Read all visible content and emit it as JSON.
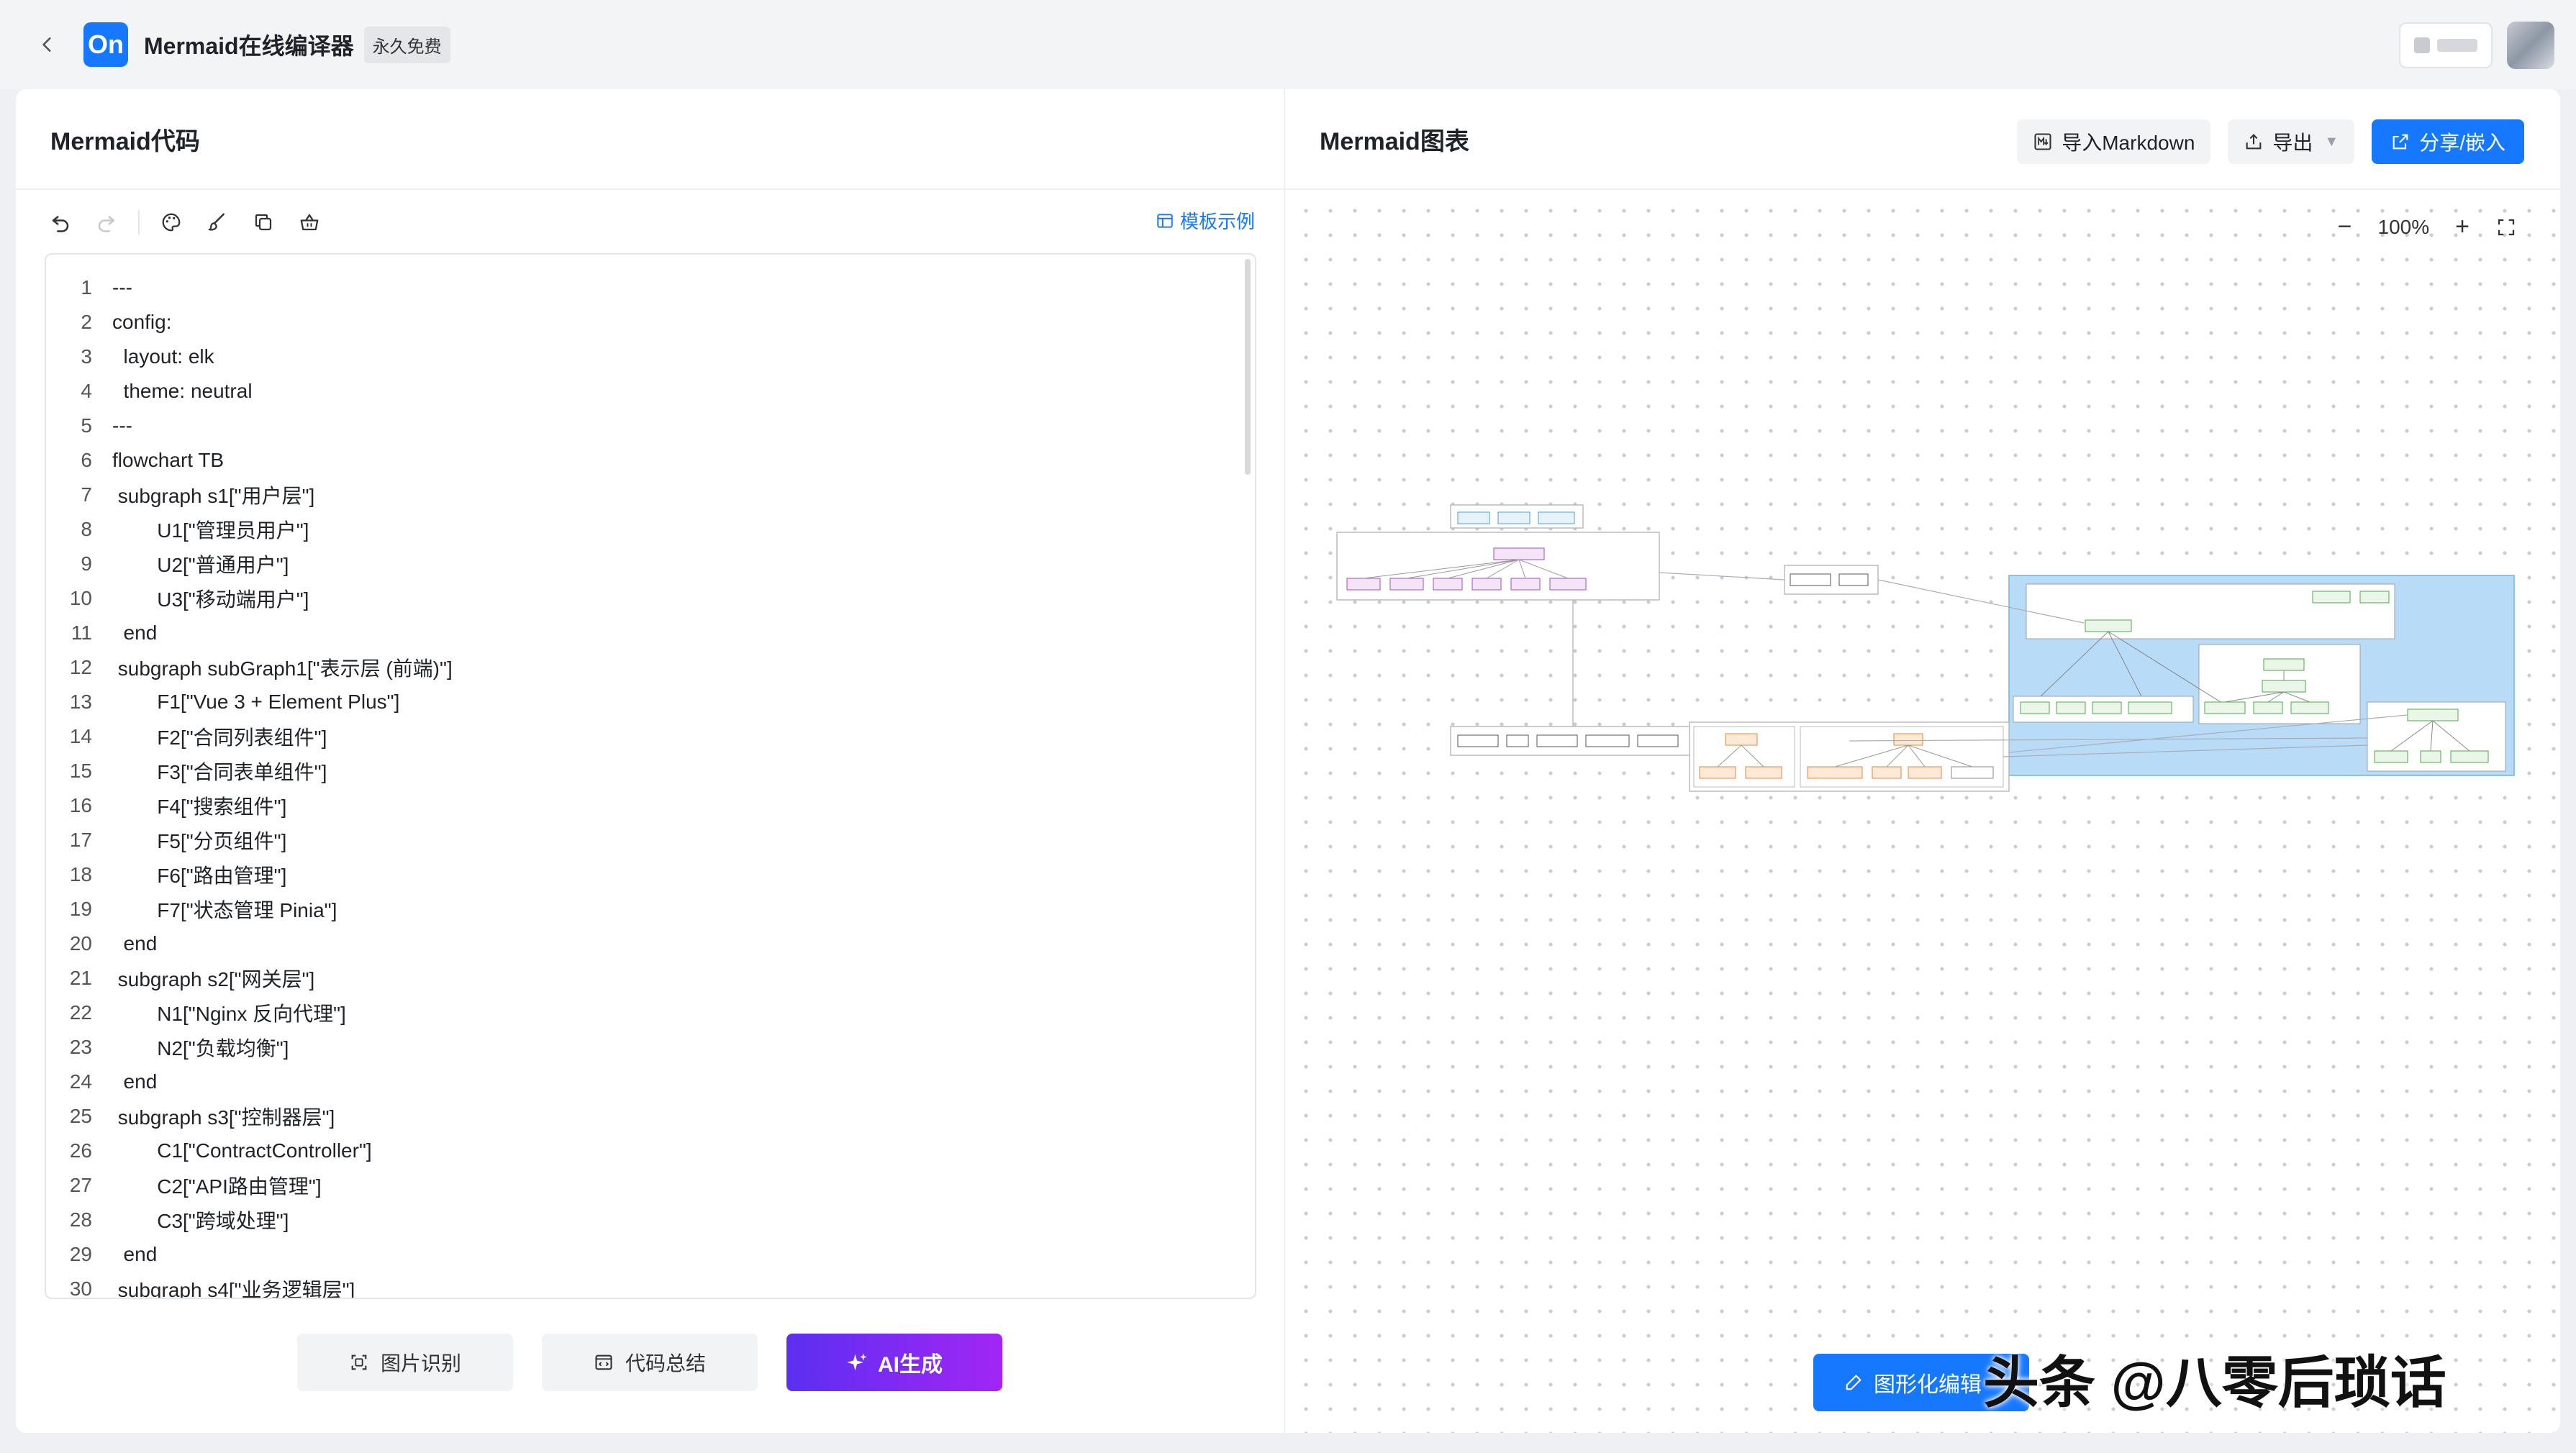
{
  "app": {
    "logo_text": "On",
    "title": "Mermaid在线编译器",
    "badge": "永久免费"
  },
  "left": {
    "title": "Mermaid代码",
    "template_link": "模板示例",
    "code_lines": [
      "---",
      "config:",
      "  layout: elk",
      "  theme: neutral",
      "---",
      "flowchart TB",
      " subgraph s1[\"用户层\"]",
      "        U1[\"管理员用户\"]",
      "        U2[\"普通用户\"]",
      "        U3[\"移动端用户\"]",
      "  end",
      " subgraph subGraph1[\"表示层 (前端)\"]",
      "        F1[\"Vue 3 + Element Plus\"]",
      "        F2[\"合同列表组件\"]",
      "        F3[\"合同表单组件\"]",
      "        F4[\"搜索组件\"]",
      "        F5[\"分页组件\"]",
      "        F6[\"路由管理\"]",
      "        F7[\"状态管理 Pinia\"]",
      "  end",
      " subgraph s2[\"网关层\"]",
      "        N1[\"Nginx 反向代理\"]",
      "        N2[\"负载均衡\"]",
      "  end",
      " subgraph s3[\"控制器层\"]",
      "        C1[\"ContractController\"]",
      "        C2[\"API路由管理\"]",
      "        C3[\"跨域处理\"]",
      "  end",
      " subgraph s4[\"业务逻辑层\"]"
    ],
    "buttons": {
      "image_recognition": "图片识别",
      "code_summary": "代码总结",
      "ai_generate": "AI生成"
    }
  },
  "right": {
    "title": "Mermaid图表",
    "import_markdown": "导入Markdown",
    "export": "导出",
    "share": "分享/嵌入",
    "zoom_minus": "−",
    "zoom_level": "100%",
    "zoom_plus": "+",
    "graph_edit": "图形化编辑",
    "watermark": "头条 @八零后琐话"
  }
}
